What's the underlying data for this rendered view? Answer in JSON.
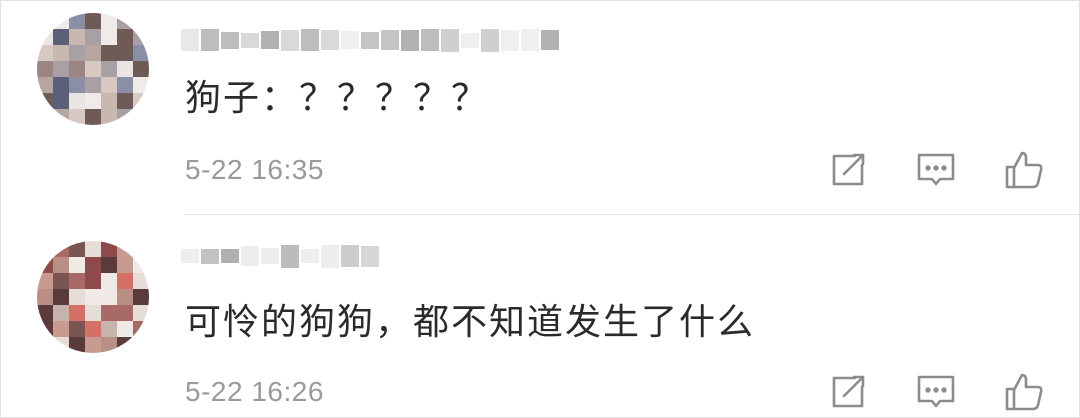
{
  "comments": [
    {
      "author_masked": true,
      "text": "狗子：？？？？？",
      "time": "5-22 16:35"
    },
    {
      "author_masked": true,
      "text": "可怜的狗狗，都不知道发生了什么",
      "time": "5-22 16:26"
    }
  ],
  "icons": {
    "share": "share-icon",
    "reply": "comment-icon",
    "like": "thumbs-up-icon"
  },
  "colors": {
    "text": "#2a2a2a",
    "timestamp": "#9a9a9a",
    "icon": "#8c8c8c",
    "divider": "#e6e6e6"
  }
}
